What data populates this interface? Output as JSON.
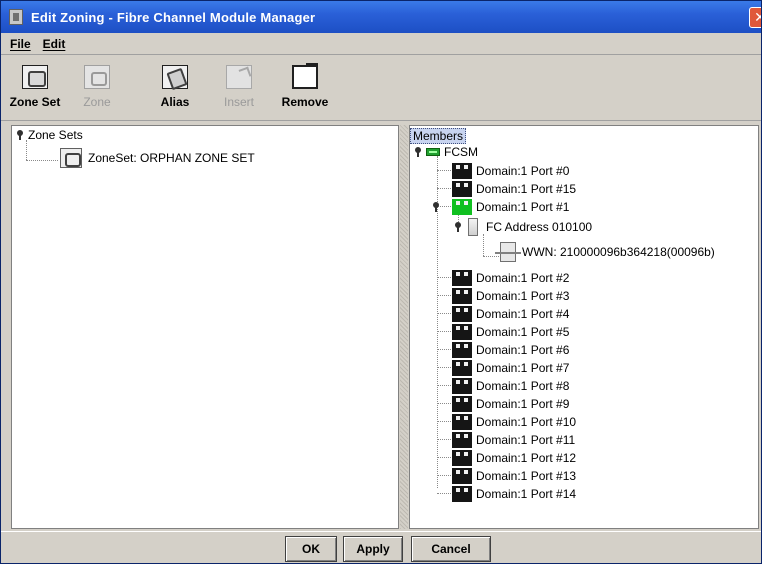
{
  "window": {
    "title": "Edit Zoning - Fibre Channel Module Manager",
    "close_glyph": "✕"
  },
  "menu": {
    "items": [
      "File",
      "Edit"
    ]
  },
  "toolbar": {
    "zone_set": "Zone Set",
    "zone": "Zone",
    "alias": "Alias",
    "insert": "Insert",
    "remove": "Remove"
  },
  "left_tree": {
    "root": "Zone Sets",
    "zoneset": "ZoneSet: ORPHAN ZONE SET"
  },
  "right_tree": {
    "header": "Members",
    "root": "FCSM",
    "ports_before": [
      "Domain:1 Port #0",
      "Domain:1 Port #15",
      "Domain:1 Port #1"
    ],
    "fc_address": "FC Address 010100",
    "wwn": "WWN: 210000096b364218(00096b)",
    "ports_after": [
      "Domain:1 Port #2",
      "Domain:1 Port #3",
      "Domain:1 Port #4",
      "Domain:1 Port #5",
      "Domain:1 Port #6",
      "Domain:1 Port #7",
      "Domain:1 Port #8",
      "Domain:1 Port #9",
      "Domain:1 Port #10",
      "Domain:1 Port #11",
      "Domain:1 Port #12",
      "Domain:1 Port #13",
      "Domain:1 Port #14"
    ]
  },
  "buttons": {
    "ok": "OK",
    "apply": "Apply",
    "cancel": "Cancel"
  }
}
